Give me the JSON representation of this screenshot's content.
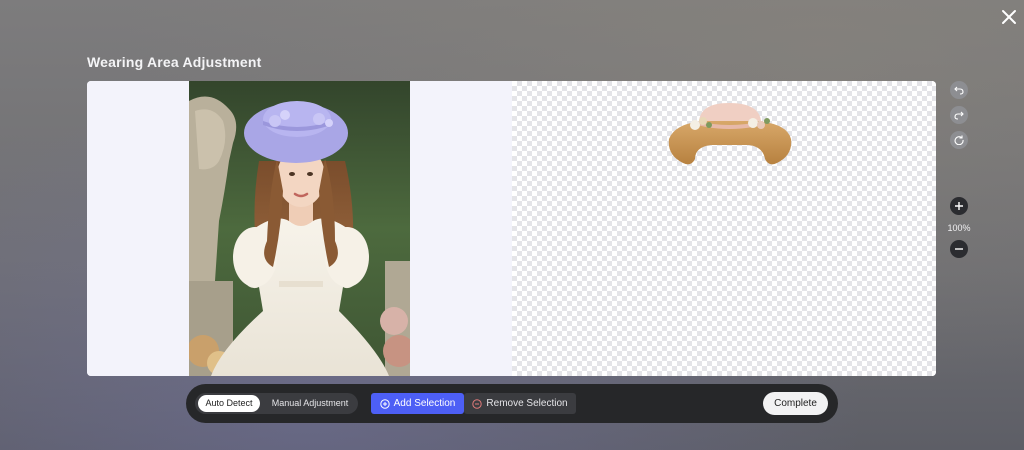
{
  "dialog": {
    "title": "Wearing Area Adjustment",
    "close_icon": "close-icon"
  },
  "preview": {
    "left": {
      "description_icon": "model-photo"
    },
    "right": {
      "description_icon": "hat-cutout"
    }
  },
  "side_tools": {
    "undo_icon": "undo-icon",
    "redo_icon": "redo-icon",
    "reset_icon": "reset-icon",
    "zoom_in_icon": "plus-icon",
    "zoom_out_icon": "minus-icon",
    "zoom_level": "100%"
  },
  "toolbar": {
    "mode_auto": "Auto Detect",
    "mode_manual": "Manual Adjustment",
    "selected_mode": "Auto Detect",
    "add_selection": "Add Selection",
    "remove_selection": "Remove Selection",
    "complete": "Complete"
  },
  "colors": {
    "accent": "#4d5ff5",
    "toolbar_bg": "#262729",
    "panel_bg": "#f3f3fb"
  }
}
